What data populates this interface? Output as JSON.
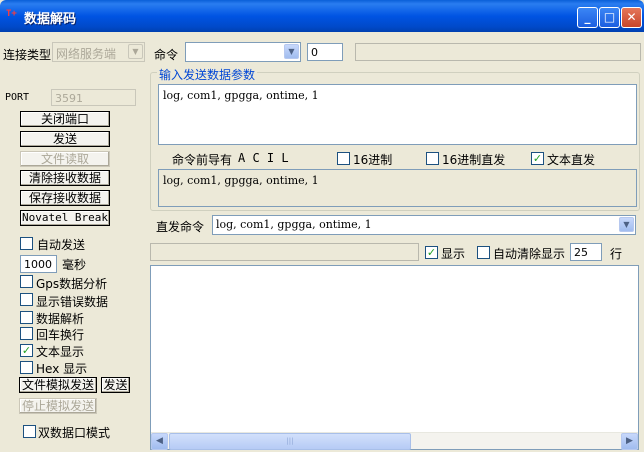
{
  "window": {
    "title": "数据解码",
    "icon_text": "T+"
  },
  "connection": {
    "type_label": "连接类型",
    "type_value": "网络服务端",
    "port_label": "PORT",
    "port_value": "3591"
  },
  "command": {
    "label": "命令",
    "select_value": "",
    "number_value": "0",
    "status_value": ""
  },
  "left_buttons": {
    "close_port": "关闭端口",
    "send": "发送",
    "file_read": "文件读取",
    "clear_recv": "清除接收数据",
    "save_recv": "保存接收数据",
    "novatel_break": "Novatel Break"
  },
  "left_options": {
    "auto_send": {
      "label": "自动发送",
      "checked": false
    },
    "interval_value": "1000",
    "interval_unit": "毫秒",
    "gps_analysis": {
      "label": "Gps数据分析",
      "checked": false
    },
    "show_errors": {
      "label": "显示错误数据",
      "checked": false
    },
    "data_parse": {
      "label": "数据解析",
      "checked": false
    },
    "crlf": {
      "label": "回车换行",
      "checked": false
    },
    "text_display": {
      "label": "文本显示",
      "checked": true
    },
    "hex_display": {
      "label": "Hex 显示",
      "checked": false
    },
    "file_sim_send": "文件模拟发送",
    "file_sim_send_go": "发送",
    "stop_sim_send": "停止模拟发送",
    "dual_port": {
      "label": "双数据口模式",
      "checked": false
    }
  },
  "send_params": {
    "legend": "输入发送数据参数",
    "input_text": "log, com1, gpgga, ontime, 1",
    "prefix_label": "命令前导有",
    "prefix_value": "A  C  I  L",
    "hex16": {
      "label": "16进制",
      "checked": false
    },
    "hex16_direct": {
      "label": "16进制直发",
      "checked": false
    },
    "text_direct": {
      "label": "文本直发",
      "checked": true
    },
    "preview_text": "log, com1, gpgga, ontime, 1"
  },
  "direct": {
    "label": "直发命令",
    "value": "log, com1, gpgga, ontime, 1"
  },
  "display": {
    "status_value": "",
    "show": {
      "label": "显示",
      "checked": true
    },
    "auto_clear": {
      "label": "自动清除显示",
      "checked": false
    },
    "lines_value": "25",
    "lines_unit": "行",
    "output_text": ""
  },
  "icons": [
    "app-icon",
    "minimize-icon",
    "maximize-icon",
    "close-icon",
    "chevron-down-icon",
    "scroll-left-icon",
    "scroll-right-icon"
  ],
  "colors": {
    "titlebar": "#0054e3",
    "background": "#ece9d8",
    "group_legend": "#0046d5"
  }
}
